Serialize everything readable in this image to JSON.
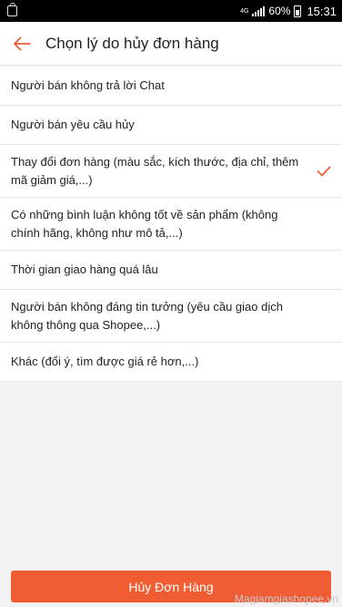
{
  "status_bar": {
    "network_label": "4G",
    "battery_percent": "60%",
    "time": "15:31"
  },
  "header": {
    "title": "Chọn lý do hủy đơn hàng",
    "back_icon": "arrow-left-icon"
  },
  "reasons": [
    {
      "label": "Người bán không trả lời Chat",
      "selected": false
    },
    {
      "label": "Người bán yêu cầu hủy",
      "selected": false
    },
    {
      "label": "Thay đổi đơn hàng (màu sắc, kích thước, địa chỉ, thêm mã giảm giá,...)",
      "selected": true
    },
    {
      "label": "Có những bình luận không tốt về sản phẩm (không chính hãng, không như mô tả,...)",
      "selected": false
    },
    {
      "label": "Thời gian giao hàng quá lâu",
      "selected": false
    },
    {
      "label": "Người bán không đáng tin tưởng (yêu cầu giao dịch không thông qua Shopee,...)",
      "selected": false
    },
    {
      "label": "Khác (đổi ý, tìm được giá rẻ hơn,...)",
      "selected": false
    }
  ],
  "footer": {
    "cancel_button_label": "Hủy Đơn Hàng"
  },
  "watermark": "Magiamgiashopee.vn",
  "colors": {
    "accent": "#f05d32",
    "background": "#f2f2f2"
  }
}
